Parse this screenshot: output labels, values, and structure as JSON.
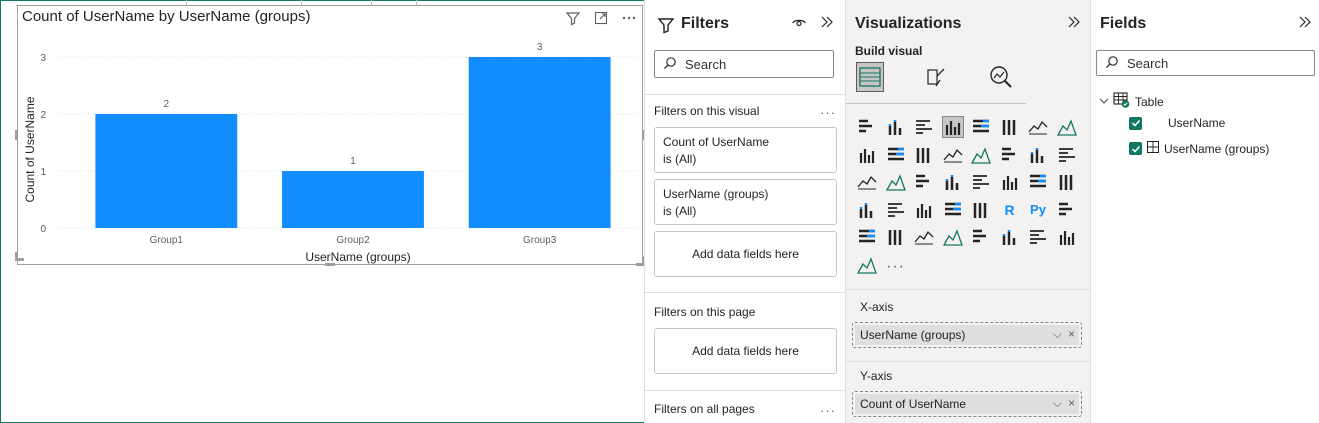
{
  "visual": {
    "title": "Count of UserName by UserName (groups)",
    "header_icons": [
      "filter-icon",
      "focus-mode-icon",
      "more-options-icon"
    ]
  },
  "chart_data": {
    "type": "bar",
    "categories": [
      "Group1",
      "Group2",
      "Group3"
    ],
    "values": [
      2,
      1,
      3
    ],
    "data_labels": [
      "2",
      "1",
      "3"
    ],
    "yticks": [
      "0",
      "1",
      "2",
      "3"
    ],
    "ylim": [
      0,
      3
    ],
    "xlabel": "UserName (groups)",
    "ylabel": "Count of UserName",
    "bar_color": "#118DFF",
    "grid": true
  },
  "filters": {
    "title": "Filters",
    "search_placeholder": "Search",
    "on_visual_label": "Filters on this visual",
    "cards": [
      {
        "name": "Count of UserName",
        "state": "is (All)"
      },
      {
        "name": "UserName (groups)",
        "state": "is (All)"
      }
    ],
    "add_label": "Add data fields here",
    "on_page_label": "Filters on this page",
    "add_label_page": "Add data fields here",
    "all_pages_label": "Filters on all pages",
    "more": "···"
  },
  "visualizations": {
    "title": "Visualizations",
    "build_label": "Build visual",
    "more_visuals": "···",
    "x_axis_label": "X-axis",
    "x_axis_field": "UserName (groups)",
    "y_axis_label": "Y-axis",
    "y_axis_field": "Count of UserName",
    "well_controls": [
      "⌵",
      "×"
    ],
    "text_icons": [
      "R",
      "Py"
    ]
  },
  "fields": {
    "title": "Fields",
    "search_placeholder": "Search",
    "table_name": "Table",
    "items": [
      {
        "label": "UserName",
        "checked": true
      },
      {
        "label": "UserName (groups)",
        "checked": true
      }
    ]
  },
  "colors": {
    "accent": "#117865",
    "bar": "#118DFF",
    "viz_pane_bg": "#F3F2F1"
  }
}
